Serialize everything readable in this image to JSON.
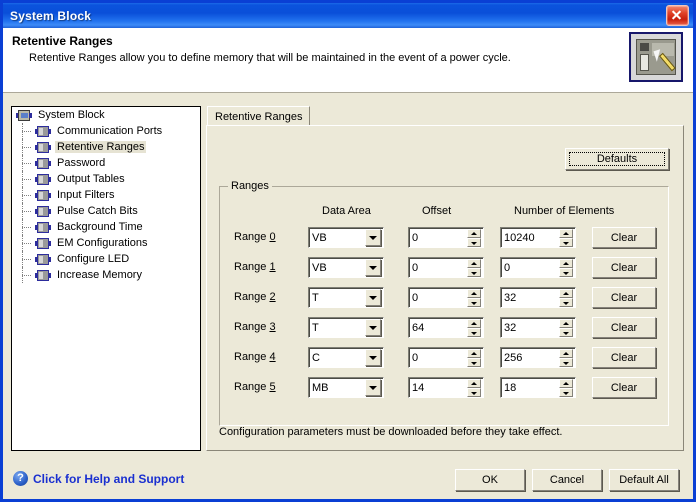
{
  "window": {
    "title": "System Block",
    "close_label": "x",
    "close_icon": "close-icon"
  },
  "header": {
    "title": "Retentive Ranges",
    "description": "Retentive Ranges allow you to define memory that will be maintained in the event of a power cycle.",
    "icon": "plc-module-edit-icon"
  },
  "sidebar": {
    "root": {
      "label": "System Block",
      "icon": "system-block-icon"
    },
    "items": [
      {
        "label": "Communication Ports",
        "icon": "plc-module-icon",
        "selected": false
      },
      {
        "label": "Retentive Ranges",
        "icon": "plc-module-icon",
        "selected": true
      },
      {
        "label": "Password",
        "icon": "plc-module-icon",
        "selected": false
      },
      {
        "label": "Output Tables",
        "icon": "plc-module-icon",
        "selected": false
      },
      {
        "label": "Input Filters",
        "icon": "plc-module-icon",
        "selected": false
      },
      {
        "label": "Pulse Catch Bits",
        "icon": "plc-module-icon",
        "selected": false
      },
      {
        "label": "Background Time",
        "icon": "plc-module-icon",
        "selected": false
      },
      {
        "label": "EM Configurations",
        "icon": "plc-module-icon",
        "selected": false
      },
      {
        "label": "Configure LED",
        "icon": "plc-module-icon",
        "selected": false
      },
      {
        "label": "Increase Memory",
        "icon": "plc-module-icon",
        "selected": false
      }
    ]
  },
  "panel": {
    "tab_label": "Retentive Ranges",
    "defaults_button": "Defaults",
    "group_label": "Ranges",
    "columns": {
      "data_area": "Data Area",
      "offset": "Offset",
      "number_of_elements": "Number of Elements"
    },
    "clear_label": "Clear",
    "note": "Configuration parameters must be downloaded before they take effect.",
    "rows": [
      {
        "label": "Range ",
        "accel": "0",
        "data_area": "VB",
        "offset": "0",
        "elements": "10240"
      },
      {
        "label": "Range ",
        "accel": "1",
        "data_area": "VB",
        "offset": "0",
        "elements": "0"
      },
      {
        "label": "Range ",
        "accel": "2",
        "data_area": "T",
        "offset": "0",
        "elements": "32"
      },
      {
        "label": "Range ",
        "accel": "3",
        "data_area": "T",
        "offset": "64",
        "elements": "32"
      },
      {
        "label": "Range ",
        "accel": "4",
        "data_area": "C",
        "offset": "0",
        "elements": "256"
      },
      {
        "label": "Range ",
        "accel": "5",
        "data_area": "MB",
        "offset": "14",
        "elements": "18"
      }
    ]
  },
  "footer": {
    "help_label": "Click for Help and Support",
    "help_icon": "question-mark-icon",
    "ok": "OK",
    "cancel": "Cancel",
    "default_all": "Default All"
  },
  "colors": {
    "titlebar_blue": "#0a4fd9",
    "dialog_face": "#ece9d8",
    "link_blue": "#1a30d0",
    "close_red": "#c81f0c",
    "selection": "#e6e3d3"
  }
}
